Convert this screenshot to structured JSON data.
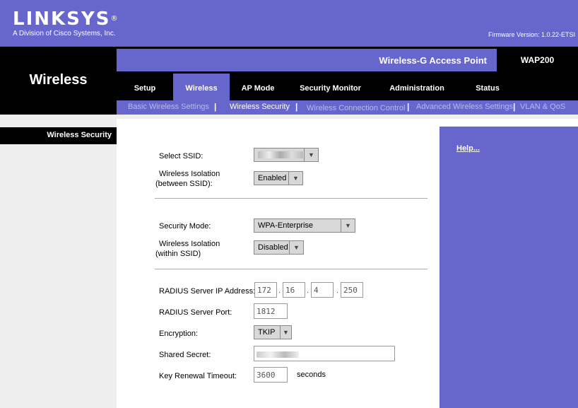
{
  "brand": {
    "logo": "LINKSYS",
    "logo_mark": "®",
    "subtitle": "A Division of Cisco Systems, Inc.",
    "firmware": "Firmware Version: 1.0.22-ETSI"
  },
  "product": {
    "name": "Wireless-G Access Point",
    "model": "WAP200"
  },
  "section_title": "Wireless",
  "menu": {
    "items": [
      {
        "label": "Setup",
        "active": false
      },
      {
        "label": "Wireless",
        "active": true
      },
      {
        "label": "AP Mode",
        "active": false
      },
      {
        "label": "Security Monitor",
        "active": false
      },
      {
        "label": "Administration",
        "active": false
      },
      {
        "label": "Status",
        "active": false
      }
    ]
  },
  "submenu": {
    "items": [
      {
        "label": "Basic Wireless Settings",
        "active": false
      },
      {
        "label": "Wireless Security",
        "active": true
      },
      {
        "label": "Wireless Connection Control",
        "active": false
      },
      {
        "label": "Advanced Wireless Settings",
        "active": false
      },
      {
        "label": "VLAN & QoS",
        "active": false
      }
    ],
    "separator": "|"
  },
  "left": {
    "title": "Wireless Security"
  },
  "help": {
    "label": "Help..."
  },
  "form": {
    "ssid": {
      "label": "Select SSID:"
    },
    "isolation_between": {
      "label_line1": "Wireless Isolation",
      "label_line2": "(between SSID):",
      "value": "Enabled"
    },
    "security_mode": {
      "label": "Security Mode:",
      "value": "WPA-Enterprise"
    },
    "isolation_within": {
      "label_line1": "Wireless Isolation",
      "label_line2": "(within SSID)",
      "value": "Disabled"
    },
    "radius_ip": {
      "label": "RADIUS Server IP Address:",
      "octets": [
        "172",
        "16",
        "4",
        "250"
      ],
      "separator": "."
    },
    "radius_port": {
      "label": "RADIUS Server Port:",
      "value": "1812"
    },
    "encryption": {
      "label": "Encryption:",
      "value": "TKIP"
    },
    "shared_secret": {
      "label": "Shared Secret:"
    },
    "key_renewal": {
      "label": "Key Renewal Timeout:",
      "value": "3600",
      "unit": "seconds"
    }
  },
  "icons": {
    "dropdown": "chevron-down-icon"
  },
  "colors": {
    "brand_purple": "#6666cc",
    "black": "#000000",
    "panel_gray": "#eeeeee"
  }
}
